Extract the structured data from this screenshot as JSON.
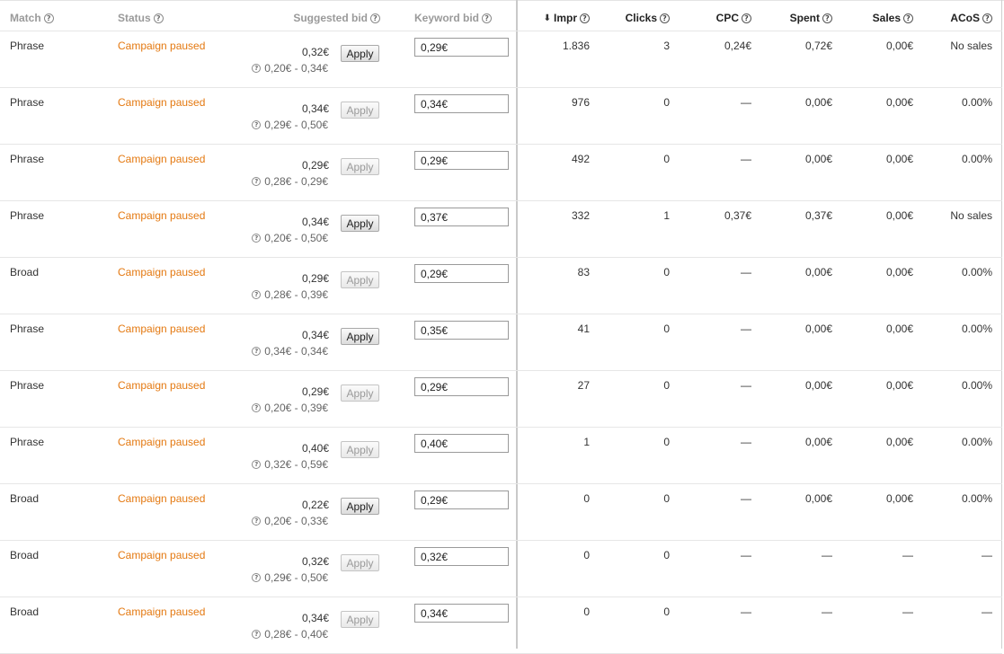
{
  "headers": {
    "match": "Match",
    "status": "Status",
    "suggested_bid": "Suggested bid",
    "keyword_bid": "Keyword bid",
    "impr": "Impr",
    "clicks": "Clicks",
    "cpc": "CPC",
    "spent": "Spent",
    "sales": "Sales",
    "acos": "ACoS"
  },
  "sort": {
    "column": "impr",
    "direction": "descending",
    "icon": "sort-down-arrow-icon"
  },
  "help_icon": "question-circle-icon",
  "colors": {
    "status_paused": "#e47911",
    "header_muted": "#9a9a9a",
    "header_dark": "#222222"
  },
  "rows": [
    {
      "match": "Phrase",
      "status": "Campaign paused",
      "suggested_bid": "0,32€",
      "suggested_range": "0,20€ - 0,34€",
      "apply_label": "Apply",
      "apply_enabled": true,
      "keyword_bid": "0,29€",
      "impr": "1.836",
      "clicks": "3",
      "cpc": "0,24€",
      "spent": "0,72€",
      "sales": "0,00€",
      "acos": "No sales"
    },
    {
      "match": "Phrase",
      "status": "Campaign paused",
      "suggested_bid": "0,34€",
      "suggested_range": "0,29€ - 0,50€",
      "apply_label": "Apply",
      "apply_enabled": false,
      "keyword_bid": "0,34€",
      "impr": "976",
      "clicks": "0",
      "cpc": "—",
      "spent": "0,00€",
      "sales": "0,00€",
      "acos": "0.00%"
    },
    {
      "match": "Phrase",
      "status": "Campaign paused",
      "suggested_bid": "0,29€",
      "suggested_range": "0,28€ - 0,29€",
      "apply_label": "Apply",
      "apply_enabled": false,
      "keyword_bid": "0,29€",
      "impr": "492",
      "clicks": "0",
      "cpc": "—",
      "spent": "0,00€",
      "sales": "0,00€",
      "acos": "0.00%"
    },
    {
      "match": "Phrase",
      "status": "Campaign paused",
      "suggested_bid": "0,34€",
      "suggested_range": "0,20€ - 0,50€",
      "apply_label": "Apply",
      "apply_enabled": true,
      "keyword_bid": "0,37€",
      "impr": "332",
      "clicks": "1",
      "cpc": "0,37€",
      "spent": "0,37€",
      "sales": "0,00€",
      "acos": "No sales"
    },
    {
      "match": "Broad",
      "status": "Campaign paused",
      "suggested_bid": "0,29€",
      "suggested_range": "0,28€ - 0,39€",
      "apply_label": "Apply",
      "apply_enabled": false,
      "keyword_bid": "0,29€",
      "impr": "83",
      "clicks": "0",
      "cpc": "—",
      "spent": "0,00€",
      "sales": "0,00€",
      "acos": "0.00%"
    },
    {
      "match": "Phrase",
      "status": "Campaign paused",
      "suggested_bid": "0,34€",
      "suggested_range": "0,34€ - 0,34€",
      "apply_label": "Apply",
      "apply_enabled": true,
      "keyword_bid": "0,35€",
      "impr": "41",
      "clicks": "0",
      "cpc": "—",
      "spent": "0,00€",
      "sales": "0,00€",
      "acos": "0.00%"
    },
    {
      "match": "Phrase",
      "status": "Campaign paused",
      "suggested_bid": "0,29€",
      "suggested_range": "0,20€ - 0,39€",
      "apply_label": "Apply",
      "apply_enabled": false,
      "keyword_bid": "0,29€",
      "impr": "27",
      "clicks": "0",
      "cpc": "—",
      "spent": "0,00€",
      "sales": "0,00€",
      "acos": "0.00%"
    },
    {
      "match": "Phrase",
      "status": "Campaign paused",
      "suggested_bid": "0,40€",
      "suggested_range": "0,32€ - 0,59€",
      "apply_label": "Apply",
      "apply_enabled": false,
      "keyword_bid": "0,40€",
      "impr": "1",
      "clicks": "0",
      "cpc": "—",
      "spent": "0,00€",
      "sales": "0,00€",
      "acos": "0.00%"
    },
    {
      "match": "Broad",
      "status": "Campaign paused",
      "suggested_bid": "0,22€",
      "suggested_range": "0,20€ - 0,33€",
      "apply_label": "Apply",
      "apply_enabled": true,
      "keyword_bid": "0,29€",
      "impr": "0",
      "clicks": "0",
      "cpc": "—",
      "spent": "0,00€",
      "sales": "0,00€",
      "acos": "0.00%"
    },
    {
      "match": "Broad",
      "status": "Campaign paused",
      "suggested_bid": "0,32€",
      "suggested_range": "0,29€ - 0,50€",
      "apply_label": "Apply",
      "apply_enabled": false,
      "keyword_bid": "0,32€",
      "impr": "0",
      "clicks": "0",
      "cpc": "—",
      "spent": "—",
      "sales": "—",
      "acos": "—"
    },
    {
      "match": "Broad",
      "status": "Campaign paused",
      "suggested_bid": "0,34€",
      "suggested_range": "0,28€ - 0,40€",
      "apply_label": "Apply",
      "apply_enabled": false,
      "keyword_bid": "0,34€",
      "impr": "0",
      "clicks": "0",
      "cpc": "—",
      "spent": "—",
      "sales": "—",
      "acos": "—"
    }
  ]
}
